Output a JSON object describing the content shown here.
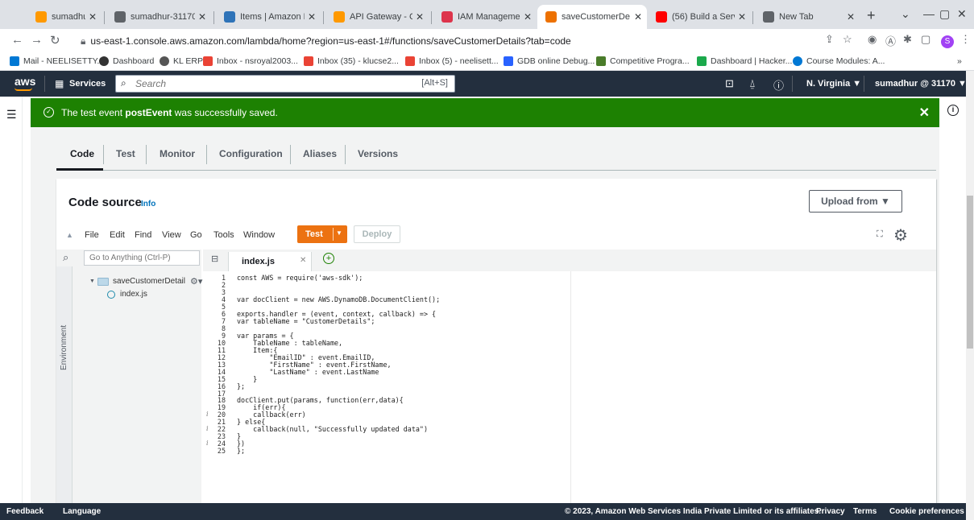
{
  "browser": {
    "tabs": [
      {
        "label": "sumadhur-31170",
        "icon": "aws-favicon",
        "color": "#ff9900"
      },
      {
        "label": "sumadhur-31170",
        "icon": "aws-favicon",
        "color": "#5f6368"
      },
      {
        "label": "Items | Amazon D",
        "icon": "dynamodb-favicon",
        "color": "#2e73b8"
      },
      {
        "label": "API Gateway - Cr",
        "icon": "apigateway-favicon",
        "color": "#ff9900"
      },
      {
        "label": "IAM Managemen",
        "icon": "iam-favicon",
        "color": "#dd344c"
      },
      {
        "label": "saveCustomerDe",
        "icon": "lambda-favicon",
        "color": "#ed7100"
      },
      {
        "label": "(56) Build a Serve",
        "icon": "youtube-favicon",
        "color": "#ff0000"
      },
      {
        "label": "New Tab",
        "icon": "chrome-favicon",
        "color": "#5f6368"
      }
    ],
    "url": "us-east-1.console.aws.amazon.com/lambda/home?region=us-east-1#/functions/saveCustomerDetails?tab=code",
    "profile_initial": "S",
    "bookmarks": [
      {
        "label": "Mail - NEELISETTY...",
        "color": "#0078d4"
      },
      {
        "label": "Dashboard",
        "color": "#333333"
      },
      {
        "label": "KL ERP",
        "color": "#555555"
      },
      {
        "label": "Inbox - nsroyal2003...",
        "color": "#ea4335"
      },
      {
        "label": "Inbox (35) - klucse2...",
        "color": "#ea4335"
      },
      {
        "label": "Inbox (5) - neelisett...",
        "color": "#ea4335"
      },
      {
        "label": "GDB online Debug...",
        "color": "#2962ff"
      },
      {
        "label": "Competitive Progra...",
        "color": "#4a7c2a"
      },
      {
        "label": "Dashboard | Hacker...",
        "color": "#1ba94c"
      },
      {
        "label": "Course Modules: A...",
        "color": "#0078d4"
      }
    ],
    "more_bookmarks": "»"
  },
  "aws_nav": {
    "logo": "aws",
    "services": "Services",
    "search_placeholder": "Search",
    "search_shortcut": "[Alt+S]",
    "region": "N. Virginia ▼",
    "account": "sumadhur @ 31170 ▼"
  },
  "flash": {
    "prefix": "The test event ",
    "event_name": "postEvent",
    "suffix": " was successfully saved."
  },
  "page_tabs": [
    "Code",
    "Test",
    "Monitor",
    "Configuration",
    "Aliases",
    "Versions"
  ],
  "panel": {
    "title": "Code source",
    "info": "Info",
    "upload": "Upload from ▼"
  },
  "ide": {
    "menu": [
      "File",
      "Edit",
      "Find",
      "View",
      "Go",
      "Tools",
      "Window"
    ],
    "test_label": "Test",
    "deploy_label": "Deploy",
    "goto_placeholder": "Go to Anything (Ctrl-P)",
    "env_label": "Environment",
    "folder": "saveCustomerDetail",
    "file": "index.js",
    "open_tab": "index.js",
    "code_lines": [
      {
        "n": "1",
        "text": "const AWS = require('aws-sdk');"
      },
      {
        "n": "2",
        "text": ""
      },
      {
        "n": "3",
        "text": ""
      },
      {
        "n": "4",
        "text": "var docClient = new AWS.DynamoDB.DocumentClient();"
      },
      {
        "n": "5",
        "text": ""
      },
      {
        "n": "6",
        "text": "exports.handler = (event, context, callback) => {"
      },
      {
        "n": "7",
        "text": "var tableName = \"CustomerDetails\";"
      },
      {
        "n": "8",
        "text": ""
      },
      {
        "n": "9",
        "text": "var params = {"
      },
      {
        "n": "10",
        "text": "    TableName : tableName,"
      },
      {
        "n": "11",
        "text": "    Item:{"
      },
      {
        "n": "12",
        "text": "        \"EmailID\" : event.EmailID,"
      },
      {
        "n": "13",
        "text": "        \"FirstName\" : event.FirstName,"
      },
      {
        "n": "14",
        "text": "        \"LastName\" : event.LastName"
      },
      {
        "n": "15",
        "text": "    }"
      },
      {
        "n": "16",
        "text": "};"
      },
      {
        "n": "17",
        "text": ""
      },
      {
        "n": "18",
        "text": "docClient.put(params, function(err,data){"
      },
      {
        "n": "19",
        "text": "    if(err){"
      },
      {
        "n": "20",
        "text": "    callback(err)",
        "info": true
      },
      {
        "n": "21",
        "text": "} else{"
      },
      {
        "n": "22",
        "text": "    callback(null, \"Successfully updated data\")",
        "info": true
      },
      {
        "n": "23",
        "text": "}"
      },
      {
        "n": "24",
        "text": "})",
        "info": true
      },
      {
        "n": "25",
        "text": "};"
      }
    ]
  },
  "footer": {
    "feedback": "Feedback",
    "language": "Language",
    "copyright": "© 2023, Amazon Web Services India Private Limited or its affiliates.",
    "privacy": "Privacy",
    "terms": "Terms",
    "cookies": "Cookie preferences"
  }
}
